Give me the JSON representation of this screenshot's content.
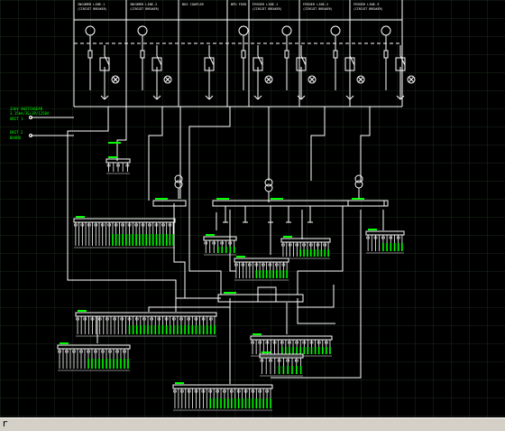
{
  "drawing": {
    "panel_headers": [
      {
        "title": "INCOMER LINE-1",
        "subtitle": "(CIRCUIT BREAKER)"
      },
      {
        "title": "INCOMER LINE-2",
        "subtitle": "(CIRCUIT BREAKER)"
      },
      {
        "title": "BUS COUPLER",
        "subtitle": ""
      },
      {
        "title": "BPU FEED",
        "subtitle": ""
      },
      {
        "title": "FEEDER LINE-1",
        "subtitle": "(CIRCUIT BREAKER)"
      },
      {
        "title": "FEEDER LINE-2",
        "subtitle": "(CIRCUIT BREAKER)"
      },
      {
        "title": "FEEDER LINE-3",
        "subtitle": "(CIRCUIT BREAKER)"
      }
    ],
    "notes": [
      {
        "line1": "33kV SWITCHGEAR",
        "line2": "3.15kA/3S/3P/1250A",
        "line3": "UNIT 1"
      },
      {
        "line1": "UNIT 2",
        "line2": "BOARD"
      }
    ],
    "colors": {
      "background": "#000000",
      "grid": "#1c2a1c",
      "wire": "#ffffff",
      "label": "#00ff00",
      "bus": "#ffffff"
    }
  },
  "statusbar": {
    "prompt": "r"
  }
}
